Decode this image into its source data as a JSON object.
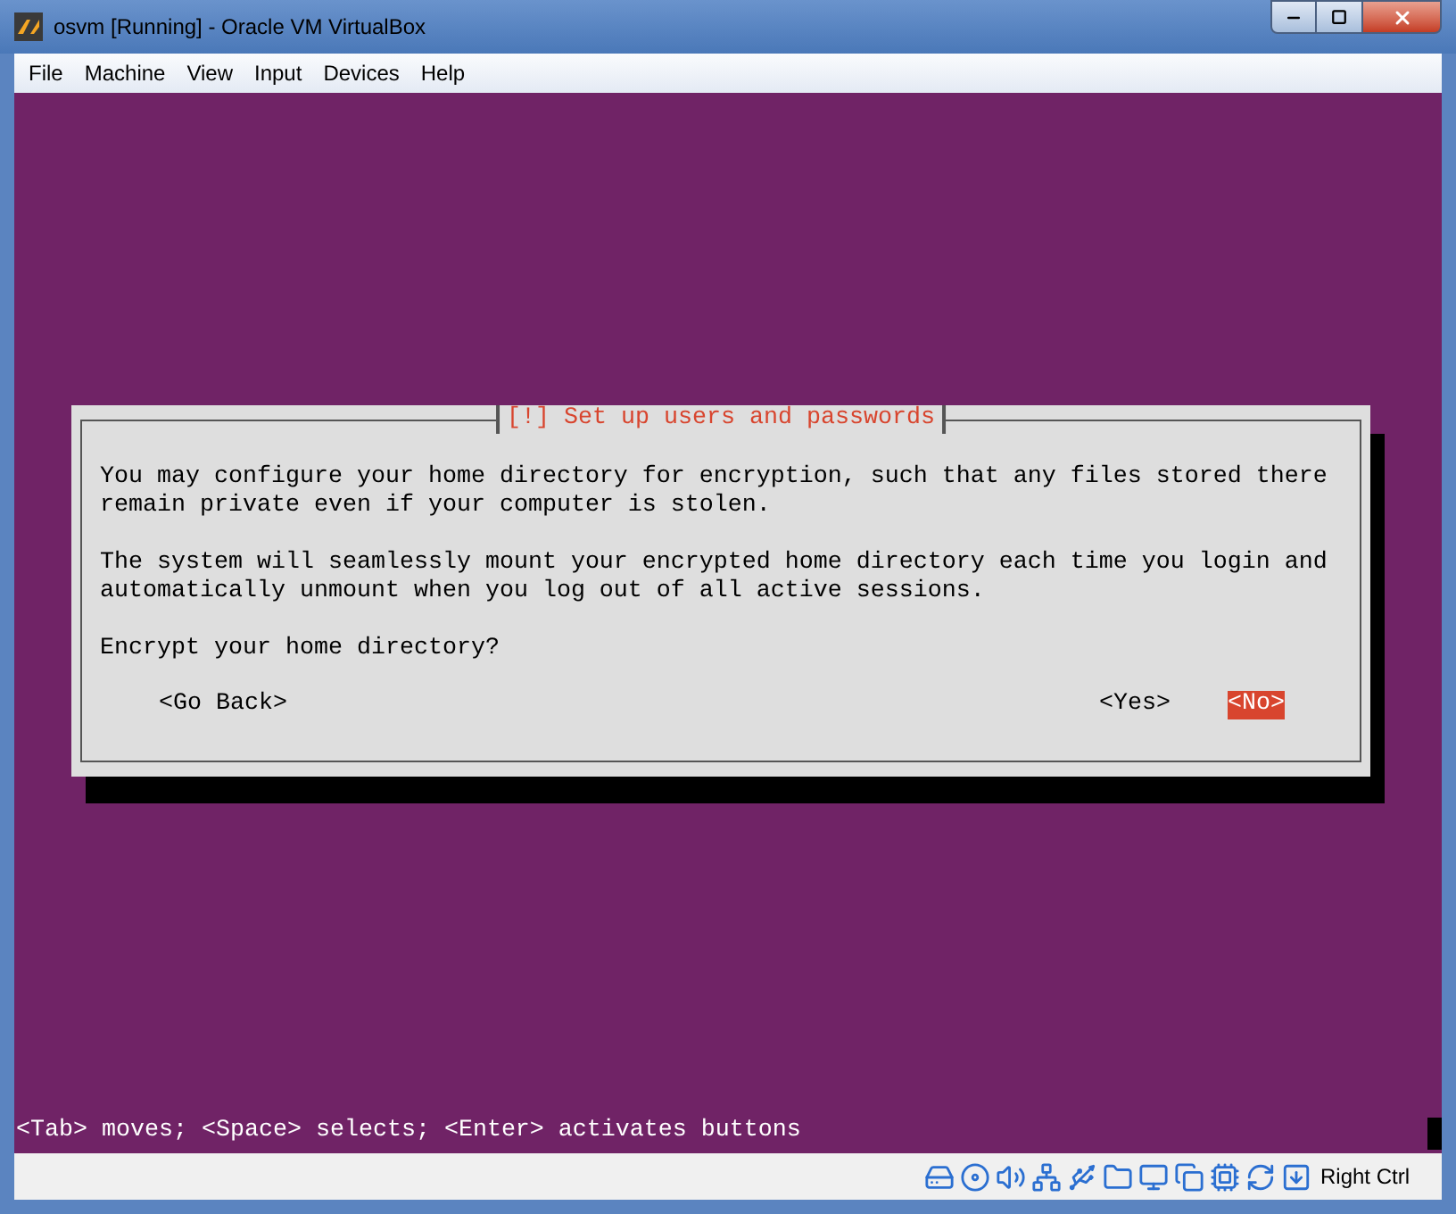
{
  "window": {
    "title": "osvm [Running] - Oracle VM VirtualBox"
  },
  "menu": [
    "File",
    "Machine",
    "View",
    "Input",
    "Devices",
    "Help"
  ],
  "dialog": {
    "title": "[!] Set up users and passwords",
    "paragraphs": [
      "You may configure your home directory for encryption, such that any files stored there remain private even if your computer is stolen.",
      "The system will seamlessly mount your encrypted home directory each time you login and automatically unmount when you log out of all active sessions.",
      "Encrypt your home directory?"
    ],
    "buttons": [
      {
        "label": "<Go Back>",
        "selected": false
      },
      {
        "label": "<Yes>",
        "selected": false
      },
      {
        "label": "<No>",
        "selected": true
      }
    ]
  },
  "hint_line": "<Tab> moves; <Space> selects; <Enter> activates buttons",
  "status_bar": {
    "host_key": "Right Ctrl"
  }
}
